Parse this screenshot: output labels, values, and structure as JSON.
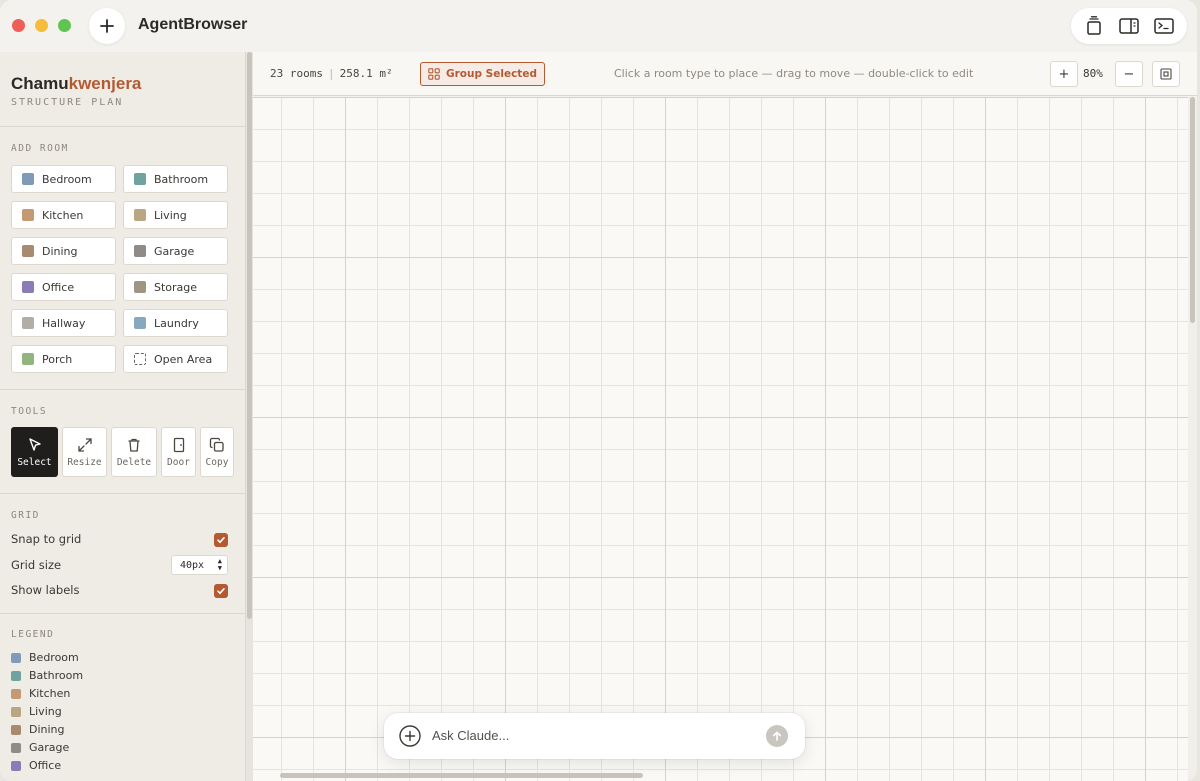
{
  "app": {
    "title": "AgentBrowser"
  },
  "brand": {
    "name_primary": "Chamu",
    "name_accent": "kwenjera",
    "subtitle": "STRUCTURE PLAN"
  },
  "add_room": {
    "label": "ADD ROOM",
    "rooms": [
      {
        "label": "Bedroom",
        "color": "#7f9bb8"
      },
      {
        "label": "Bathroom",
        "color": "#6fa39f"
      },
      {
        "label": "Kitchen",
        "color": "#c39a73"
      },
      {
        "label": "Living",
        "color": "#bca583"
      },
      {
        "label": "Dining",
        "color": "#a88a70"
      },
      {
        "label": "Garage",
        "color": "#8f8c88"
      },
      {
        "label": "Office",
        "color": "#8b7cb8"
      },
      {
        "label": "Storage",
        "color": "#a09585"
      },
      {
        "label": "Hallway",
        "color": "#b2aea7"
      },
      {
        "label": "Laundry",
        "color": "#87a9bf"
      },
      {
        "label": "Porch",
        "color": "#92b47f"
      },
      {
        "label": "Open Area",
        "color": "dashed"
      }
    ]
  },
  "tools": {
    "label": "TOOLS",
    "items": [
      {
        "label": "Select",
        "icon": "cursor-icon",
        "active": true
      },
      {
        "label": "Resize",
        "icon": "resize-icon"
      },
      {
        "label": "Delete",
        "icon": "trash-icon"
      },
      {
        "label": "Door",
        "icon": "door-icon"
      },
      {
        "label": "Copy",
        "icon": "copy-icon"
      }
    ]
  },
  "grid": {
    "label": "GRID",
    "snap_label": "Snap to grid",
    "snap_checked": true,
    "size_label": "Grid size",
    "size_value": "40px",
    "labels_label": "Show labels",
    "labels_checked": true
  },
  "legend": {
    "label": "LEGEND",
    "items": [
      {
        "label": "Bedroom",
        "color": "#7f9bb8"
      },
      {
        "label": "Bathroom",
        "color": "#6fa39f"
      },
      {
        "label": "Kitchen",
        "color": "#c39a73"
      },
      {
        "label": "Living",
        "color": "#bca583"
      },
      {
        "label": "Dining",
        "color": "#a88a70"
      },
      {
        "label": "Garage",
        "color": "#8f8c88"
      },
      {
        "label": "Office",
        "color": "#8b7cb8"
      }
    ]
  },
  "toolbar": {
    "rooms_count": "23 rooms",
    "area": "258.1 m²",
    "group_label": "Group Selected",
    "hint": "Click a room type to place — drag to move — double-click to edit",
    "zoom_in": "+",
    "zoom_level": "80%",
    "zoom_out": "−"
  },
  "ask": {
    "placeholder": "Ask Claude..."
  },
  "colors": {
    "accent": "#b45a33",
    "active_tool": "#1f1e1c"
  }
}
